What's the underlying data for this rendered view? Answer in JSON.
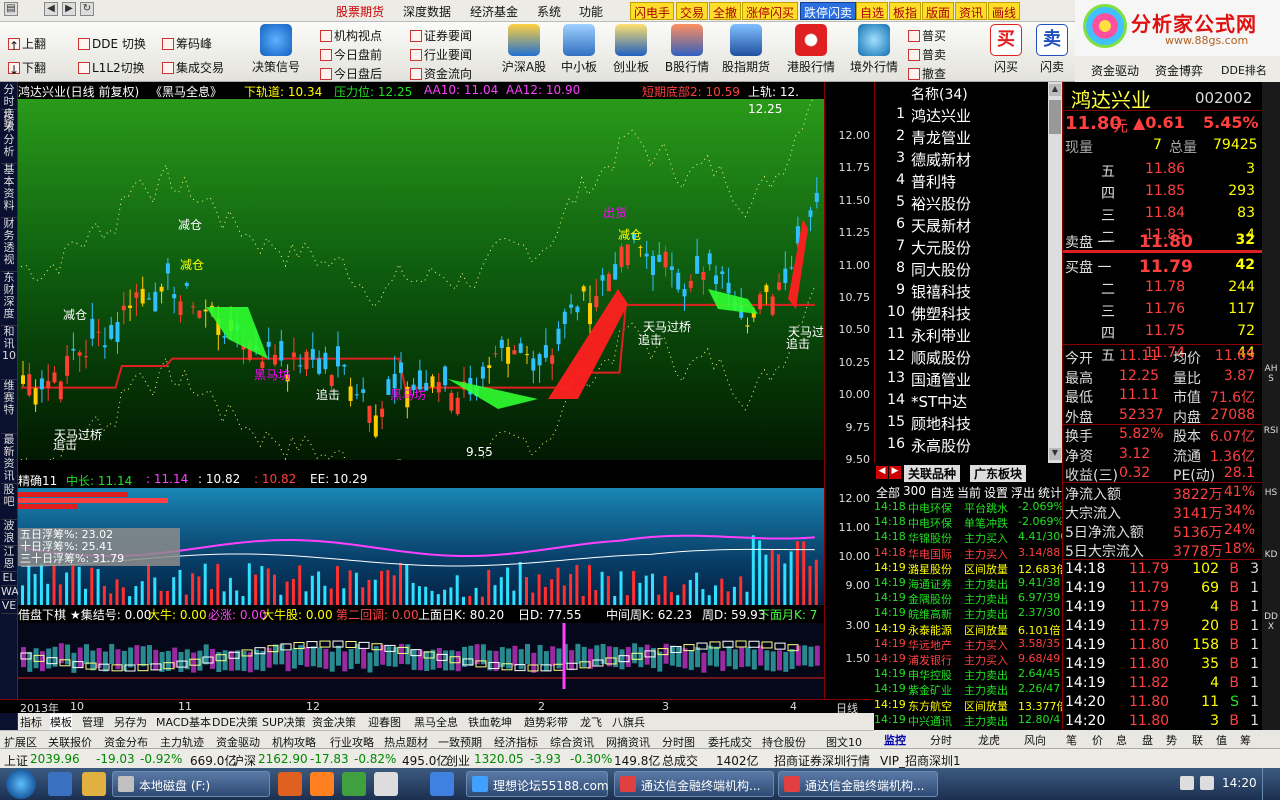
{
  "menubar": {
    "items": [
      "股票期货",
      "深度数据",
      "经济基金",
      "系统",
      "功能"
    ],
    "highlight": [
      "闪电手",
      "交易",
      "全撤",
      "涨停闪买",
      "跌停闪卖",
      "自选",
      "板指",
      "版面",
      "资讯",
      "画线"
    ]
  },
  "toolbar": {
    "left": [
      "上翻",
      "下翻",
      "DDE 切换",
      "L1L2切换",
      "筹码峰",
      "集成交易",
      "决策信号"
    ],
    "mid": [
      "机构视点",
      "今日盘前",
      "今日盘后",
      "证券要闻",
      "行业要闻",
      "资金流向"
    ],
    "big": [
      "沪深A股",
      "中小板",
      "创业板",
      "B股行情",
      "股指期货",
      "港股行情",
      "境外行情"
    ],
    "right": [
      "普买",
      "普卖",
      "撤查",
      "闪买",
      "闪卖",
      "资金驱动",
      "资金博弈",
      "DDE排名"
    ],
    "icons": {
      "flash_buy": "买",
      "flash_sell": "卖"
    }
  },
  "logo": {
    "title": "分析家公式网",
    "url": "www.88gs.com"
  },
  "left_tabs": [
    "分时走势",
    "技术分析",
    "基本资料",
    "财务透视",
    "东财深度",
    "和讯10",
    "维赛特",
    "最新资讯",
    "股吧",
    "波浪",
    "江恩",
    "EL",
    "WA",
    "VE"
  ],
  "chart": {
    "header": {
      "title": "鸿达兴业(日线 前复权)",
      "formula": "《黑马全息》",
      "lower": "下轨道: 10.34",
      "pressure": "压力位: 12.25",
      "aa10": "AA10: 11.04",
      "aa12": "AA12: 10.90",
      "short_bottom": "短期底部2: 10.59",
      "upper": "上轨: 12."
    },
    "labels": [
      "减仓",
      "减仓",
      "减仓",
      "减仓",
      "出货",
      "天马过桥",
      "天马过桥",
      "天马过桥",
      "黑马坊",
      "黑马坊",
      "追击",
      "追击",
      "追击",
      "追击",
      "9.55",
      "12.25"
    ],
    "y_ticks": [
      "12.00",
      "11.75",
      "11.50",
      "11.25",
      "11.00",
      "10.75",
      "10.50",
      "10.25",
      "10.00",
      "9.75",
      "9.50"
    ],
    "ind1": {
      "name": "精确11",
      "mid": "中长: 11.14",
      "v2": ": 11.14",
      "v3": ": 10.82",
      "v4": ": 10.82",
      "ee": "EE: 10.29",
      "box": [
        "五日浮筹%: 23.02",
        "十日浮筹%: 25.41",
        "三十日浮筹%: 31.79"
      ],
      "y_ticks": [
        "12.00",
        "11.00",
        "10.00",
        "9.00"
      ]
    },
    "ind2": {
      "items": [
        "借盘下棋",
        "★集结号: 0.00",
        "大牛: 0.00",
        "必涨: 0.00",
        "大牛股: 0.00",
        "第二回调: 0.00",
        "上面日K: 80.20",
        "日D: 77.55",
        "中间周K: 62.23",
        "周D: 59.93",
        "下面月K: 7"
      ],
      "y_ticks": [
        "3.00",
        "1.50"
      ]
    },
    "dates": [
      "2013年",
      "10",
      "11",
      "12",
      "2",
      "3",
      "4"
    ],
    "period": "日线"
  },
  "bottom_tabs1": [
    "指标",
    "模板",
    "管理",
    "另存为",
    "MACD基本",
    "DDE决策",
    "SUP决策",
    "资金决策",
    "迎春图",
    "黑马全息",
    "铁血乾坤",
    "趋势彩带",
    "龙飞",
    "八旗兵"
  ],
  "bottom_tabs2": [
    "扩展区",
    "关联报价",
    "资金分布",
    "主力轨迹",
    "资金驱动",
    "机构攻略",
    "行业攻略",
    "热点题材",
    "一致预期",
    "经济指标",
    "综合资讯",
    "网摘资讯",
    "分时图",
    "委托成交",
    "持仓股份",
    "图文10"
  ],
  "list": {
    "header": "名称(34)",
    "rows": [
      {
        "n": "1",
        "s": "鸿达兴业"
      },
      {
        "n": "2",
        "s": "青龙管业"
      },
      {
        "n": "3",
        "s": "德威新材"
      },
      {
        "n": "4",
        "s": "普利特"
      },
      {
        "n": "5",
        "s": "裕兴股份"
      },
      {
        "n": "6",
        "s": "天晟新材"
      },
      {
        "n": "7",
        "s": "大元股份"
      },
      {
        "n": "8",
        "s": "同大股份"
      },
      {
        "n": "9",
        "s": "银禧科技"
      },
      {
        "n": "10",
        "s": "佛塑科技"
      },
      {
        "n": "11",
        "s": "永利带业"
      },
      {
        "n": "12",
        "s": "顺威股份"
      },
      {
        "n": "13",
        "s": "国通管业"
      },
      {
        "n": "14",
        "s": "*ST中达"
      },
      {
        "n": "15",
        "s": "顾地科技"
      },
      {
        "n": "16",
        "s": "永高股份"
      }
    ]
  },
  "rel_tabs": [
    "关联品种",
    "广东板块"
  ],
  "ticker": {
    "tabs": [
      "全部",
      "300",
      "自选",
      "当前",
      "设置",
      "浮出",
      "统计"
    ],
    "rows": [
      {
        "t": "14:18",
        "s": "中电环保",
        "type": "平台跳水",
        "v": "-2.069%",
        "c": "green"
      },
      {
        "t": "14:18",
        "s": "中电环保",
        "type": "单笔冲跌",
        "v": "-2.069%",
        "c": "green"
      },
      {
        "t": "14:18",
        "s": "华锦股份",
        "type": "主力买入",
        "v": "4.41/300",
        "c": "green"
      },
      {
        "t": "14:18",
        "s": "华电国际",
        "type": "主力买入",
        "v": "3.14/88",
        "c": "red"
      },
      {
        "t": "14:19",
        "s": "潞星股份",
        "type": "区间放量",
        "v": "12.683倍",
        "c": "yellow"
      },
      {
        "t": "14:19",
        "s": "海通证券",
        "type": "主力卖出",
        "v": "9.41/38",
        "c": "green"
      },
      {
        "t": "14:19",
        "s": "金隅股份",
        "type": "主力卖出",
        "v": "6.97/39",
        "c": "green"
      },
      {
        "t": "14:19",
        "s": "皖维高新",
        "type": "主力卖出",
        "v": "2.37/30",
        "c": "green"
      },
      {
        "t": "14:19",
        "s": "永泰能源",
        "type": "区间放量",
        "v": "6.101倍",
        "c": "yellow"
      },
      {
        "t": "14:19",
        "s": "华远地产",
        "type": "主力买入",
        "v": "3.58/35",
        "c": "red"
      },
      {
        "t": "14:19",
        "s": "浦发银行",
        "type": "主力买入",
        "v": "9.68/49",
        "c": "red"
      },
      {
        "t": "14:19",
        "s": "申华控股",
        "type": "主力卖出",
        "v": "2.64/45",
        "c": "green"
      },
      {
        "t": "14:19",
        "s": "紫金矿业",
        "type": "主力卖出",
        "v": "2.26/47",
        "c": "green"
      },
      {
        "t": "14:19",
        "s": "东方航空",
        "type": "区间放量",
        "v": "13.377倍",
        "c": "yellow"
      },
      {
        "t": "14:19",
        "s": "中兴通讯",
        "type": "主力卖出",
        "v": "12.80/4",
        "c": "green"
      }
    ]
  },
  "quote": {
    "name": "鸿达兴业",
    "code": "002002",
    "price": "11.80",
    "unit": "元",
    "chg": "▲0.61",
    "pct": "5.45%",
    "now_label": "现量",
    "now": "7",
    "total_label": "总量",
    "total": "79425",
    "asks": [
      {
        "l": "五",
        "p": "11.86",
        "v": "3"
      },
      {
        "l": "四",
        "p": "11.85",
        "v": "293"
      },
      {
        "l": "三",
        "p": "11.84",
        "v": "83"
      },
      {
        "l": "二",
        "p": "11.83",
        "v": "4"
      }
    ],
    "ask1": {
      "l": "卖盘 一",
      "p": "11.80",
      "v": "32"
    },
    "bid1": {
      "l": "买盘 一",
      "p": "11.79",
      "v": "42"
    },
    "bids": [
      {
        "l": "二",
        "p": "11.78",
        "v": "244"
      },
      {
        "l": "三",
        "p": "11.76",
        "v": "117"
      },
      {
        "l": "四",
        "p": "11.75",
        "v": "72"
      },
      {
        "l": "五",
        "p": "11.74",
        "v": "44"
      }
    ],
    "stats": [
      {
        "a": "今开",
        "b": "11.11",
        "c": "均价",
        "d": "11.69"
      },
      {
        "a": "最高",
        "b": "12.25",
        "c": "量比",
        "d": "3.87"
      },
      {
        "a": "最低",
        "b": "11.11",
        "c": "市值",
        "d": "71.6亿"
      },
      {
        "a": "外盘",
        "b": "52337",
        "c": "内盘",
        "d": "27088"
      }
    ],
    "stats2": [
      {
        "a": "换手",
        "b": "5.82%",
        "c": "股本",
        "d": "6.07亿"
      },
      {
        "a": "净资",
        "b": "3.12",
        "c": "流通",
        "d": "1.36亿"
      },
      {
        "a": "收益(三)",
        "b": "0.32",
        "c": "PE(动)",
        "d": "28.1"
      }
    ],
    "flows": [
      {
        "a": "净流入额",
        "b": "3822万",
        "c": "41%"
      },
      {
        "a": "大宗流入",
        "b": "3141万",
        "c": "34%"
      },
      {
        "a": "5日净流入额",
        "b": "5136万",
        "c": "24%"
      },
      {
        "a": "5日大宗流入",
        "b": "3778万",
        "c": "18%"
      }
    ],
    "trades": [
      {
        "t": "14:18",
        "p": "11.79",
        "v": "102",
        "d": "B",
        "n": "3"
      },
      {
        "t": "14:19",
        "p": "11.79",
        "v": "69",
        "d": "B",
        "n": "1"
      },
      {
        "t": "14:19",
        "p": "11.79",
        "v": "4",
        "d": "B",
        "n": "1"
      },
      {
        "t": "14:19",
        "p": "11.79",
        "v": "20",
        "d": "B",
        "n": "1"
      },
      {
        "t": "14:19",
        "p": "11.80",
        "v": "158",
        "d": "B",
        "n": "1"
      },
      {
        "t": "14:19",
        "p": "11.80",
        "v": "35",
        "d": "B",
        "n": "1"
      },
      {
        "t": "14:19",
        "p": "11.82",
        "v": "4",
        "d": "B",
        "n": "1"
      },
      {
        "t": "14:20",
        "p": "11.80",
        "v": "11",
        "d": "S",
        "n": "1"
      },
      {
        "t": "14:20",
        "p": "11.80",
        "v": "3",
        "d": "B",
        "n": "1"
      }
    ]
  },
  "right_tabs": [
    "AHS",
    "RSI",
    "HS",
    "KD",
    "DDX"
  ],
  "rbottom_tabs": [
    "监控",
    "分时",
    "龙虎",
    "风向",
    "笔",
    "价",
    "息",
    "盘",
    "势",
    "联",
    "值",
    "筹"
  ],
  "status": {
    "sh_label": "上证",
    "sh": "2039.96",
    "sh_chg": "-19.03",
    "sh_pct": "-0.92%",
    "sh_vol": "669.0亿",
    "hs_label": "沪深",
    "hs": "2162.90",
    "hs_chg": "-17.83",
    "hs_pct": "-0.82%",
    "hs_vol": "495.0亿",
    "cy_label": "创业",
    "cy": "1320.05",
    "cy_chg": "-3.93",
    "cy_pct": "-0.30%",
    "cy_vol": "149.8亿",
    "total_label": "总成交",
    "total": "1402亿",
    "broker": "招商证券深圳行情",
    "vip": "VIP_招商深圳1"
  },
  "taskbar": {
    "items": [
      "本地磁盘 (F:)",
      "理想论坛55188.com",
      "通达信金融终端机构...",
      "通达信金融终端机构..."
    ],
    "time": "14:20"
  },
  "colors": {
    "up": "#ff4040",
    "down": "#20e020",
    "accent": "#ffde2a"
  }
}
